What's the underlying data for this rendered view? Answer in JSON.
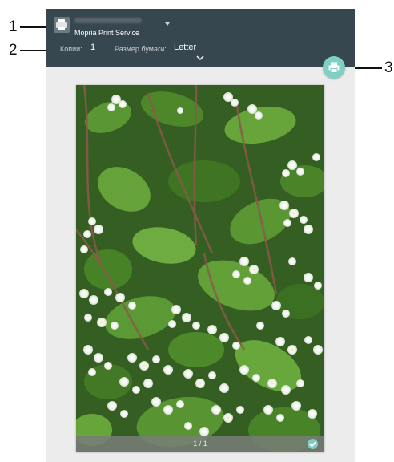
{
  "callouts": {
    "c1": "1",
    "c2": "2",
    "c3": "3"
  },
  "header": {
    "printer_icon": "printer-icon",
    "service_name": "Mopria Print Service",
    "copies_label": "Копии:",
    "copies_value": "1",
    "paper_size_label": "Размер бумаги:",
    "paper_size_value": "Letter"
  },
  "print_button": {
    "icon": "print-icon"
  },
  "preview": {
    "page_counter": "1 / 1",
    "photo": "buckwheat-flowers-photo",
    "selected_icon": "check-circle-icon"
  },
  "colors": {
    "header_bg": "#37474f",
    "fab": "#7fcfc4",
    "screen_bg": "#ececec"
  }
}
